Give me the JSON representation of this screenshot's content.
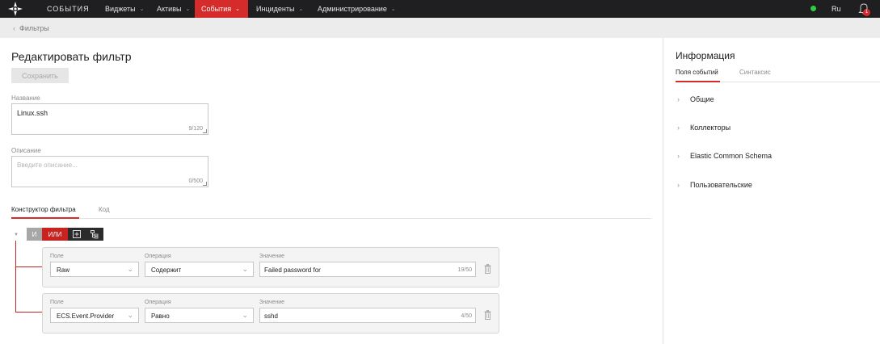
{
  "topbar": {
    "app_title": "СОБЫТИЯ",
    "nav": [
      {
        "label": "Виджеты",
        "active": false
      },
      {
        "label": "Активы",
        "active": false
      },
      {
        "label": "События",
        "active": true
      },
      {
        "label": "Инциденты",
        "active": false
      },
      {
        "label": "Администрирование",
        "active": false
      }
    ],
    "status_color": "#2ecc40",
    "language": "Ru",
    "notifications_count": "1"
  },
  "breadcrumb": {
    "label": "Фильтры"
  },
  "editor": {
    "title": "Редактировать фильтр",
    "save_label": "Сохранить",
    "name": {
      "label": "Название",
      "value": "Linux.ssh",
      "counter": "9/120"
    },
    "description": {
      "label": "Описание",
      "placeholder": "Введите описание...",
      "counter": "0/500"
    },
    "tabs": [
      {
        "label": "Конструктор фильтра",
        "active": true
      },
      {
        "label": "Код",
        "active": false
      }
    ],
    "builder": {
      "and_label": "И",
      "or_label": "ИЛИ",
      "active_operator": "ИЛИ",
      "conditions": [
        {
          "field_label": "Поле",
          "field": "Raw",
          "op_label": "Операция",
          "op": "Содержит",
          "value_label": "Значение",
          "value": "Failed password for",
          "counter": "19/50"
        },
        {
          "field_label": "Поле",
          "field": "ECS.Event.Provider",
          "op_label": "Операция",
          "op": "Равно",
          "value_label": "Значение",
          "value": "sshd",
          "counter": "4/50"
        }
      ]
    }
  },
  "info": {
    "title": "Информация",
    "tabs": [
      {
        "label": "Поля событий",
        "active": true
      },
      {
        "label": "Синтаксис",
        "active": false
      }
    ],
    "sections": [
      "Общие",
      "Коллекторы",
      "Elastic Common Schema",
      "Пользовательские"
    ]
  },
  "colors": {
    "accent": "#d62b2b",
    "topbar": "#1f1f21"
  }
}
